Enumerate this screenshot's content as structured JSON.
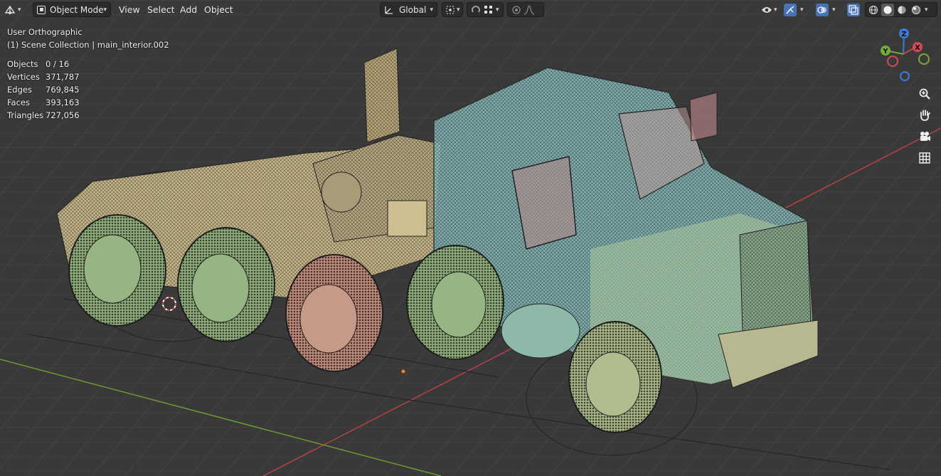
{
  "header": {
    "mode_label": "Object Mode",
    "menus": [
      "View",
      "Select",
      "Add",
      "Object"
    ],
    "transform_orientation": "Global"
  },
  "overlay": {
    "view_name": "User Orthographic",
    "collection_line": "(1) Scene Collection | main_interior.002"
  },
  "stats": [
    {
      "label": "Objects",
      "value": "0 / 16"
    },
    {
      "label": "Vertices",
      "value": "371,787"
    },
    {
      "label": "Edges",
      "value": "769,845"
    },
    {
      "label": "Faces",
      "value": "393,163"
    },
    {
      "label": "Triangles",
      "value": "727,056"
    }
  ],
  "gizmo": {
    "z": "Z",
    "y": "Y",
    "x": "X"
  },
  "colors": {
    "background": "#393939",
    "x_axis": "#b8404a",
    "y_axis": "#6d9a2d",
    "cab": "#8ec4c4",
    "chassis": "#c9b98a",
    "wheel_green": "#8fae7a",
    "wheel_red": "#c08a7a",
    "accent_blue": "#4772b3"
  }
}
